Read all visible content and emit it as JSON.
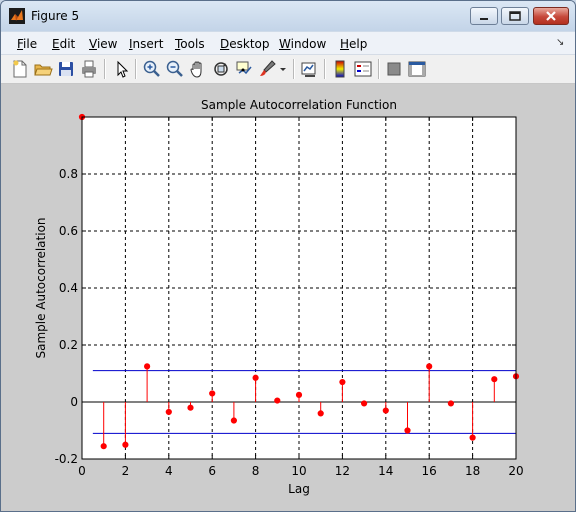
{
  "window": {
    "title": "Figure 5"
  },
  "menu": [
    {
      "pre": "",
      "u": "F",
      "post": "ile"
    },
    {
      "pre": "",
      "u": "E",
      "post": "dit"
    },
    {
      "pre": "",
      "u": "V",
      "post": "iew"
    },
    {
      "pre": "",
      "u": "I",
      "post": "nsert"
    },
    {
      "pre": "",
      "u": "T",
      "post": "ools"
    },
    {
      "pre": "",
      "u": "D",
      "post": "esktop"
    },
    {
      "pre": "",
      "u": "W",
      "post": "indow"
    },
    {
      "pre": "",
      "u": "H",
      "post": "elp"
    }
  ],
  "toolbar_icons": [
    "new-figure-icon",
    "open-file-icon",
    "save-icon",
    "print-icon",
    "edit-plot-arrow-icon",
    "zoom-in-icon",
    "zoom-out-icon",
    "pan-hand-icon",
    "rotate-3d-icon",
    "data-cursor-icon",
    "brush-icon",
    "brush-dropdown-icon",
    "link-plot-icon",
    "insert-colorbar-icon",
    "insert-legend-icon",
    "hide-plot-tools-icon",
    "show-plot-tools-icon"
  ],
  "colors": {
    "stem": "#ff0000",
    "bounds": "#0000cc",
    "axes": "#000000",
    "figure_bg": "#cccccc"
  },
  "chart_data": {
    "type": "stem",
    "title": "Sample Autocorrelation Function",
    "xlabel": "Lag",
    "ylabel": "Sample Autocorrelation",
    "xlim": [
      0,
      20
    ],
    "ylim": [
      -0.2,
      1.0
    ],
    "xticks": [
      "0",
      "2",
      "4",
      "6",
      "8",
      "10",
      "12",
      "14",
      "16",
      "18",
      "20"
    ],
    "yticks": [
      "-0.2",
      "0",
      "0.2",
      "0.4",
      "0.6",
      "0.8"
    ],
    "grid": true,
    "lags": [
      0,
      1,
      2,
      3,
      4,
      5,
      6,
      7,
      8,
      9,
      10,
      11,
      12,
      13,
      14,
      15,
      16,
      17,
      18,
      19,
      20
    ],
    "values": [
      1.0,
      -0.155,
      -0.15,
      0.125,
      -0.035,
      -0.02,
      0.03,
      -0.065,
      0.085,
      0.005,
      0.025,
      -0.04,
      0.07,
      -0.005,
      -0.03,
      -0.1,
      0.125,
      -0.005,
      -0.125,
      0.08,
      0.09
    ],
    "confidence_bounds": {
      "upper": 0.11,
      "lower": -0.11,
      "from_lag": 0.5,
      "to_lag": 20
    }
  }
}
